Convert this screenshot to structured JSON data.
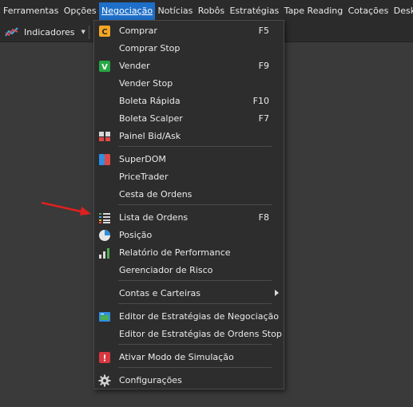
{
  "menubar": {
    "items": [
      "Ferramentas",
      "Opções",
      "Negociação",
      "Notícias",
      "Robôs",
      "Estratégias",
      "Tape Reading",
      "Cotações",
      "Desktop"
    ],
    "active_index": 2
  },
  "toolbar": {
    "indicators_label": "Indicadores"
  },
  "menu": {
    "comprar": {
      "label": "Comprar",
      "shortcut": "F5",
      "badge": "C"
    },
    "comprar_stop": {
      "label": "Comprar Stop"
    },
    "vender": {
      "label": "Vender",
      "shortcut": "F9",
      "badge": "V"
    },
    "vender_stop": {
      "label": "Vender Stop"
    },
    "boleta_rapida": {
      "label": "Boleta Rápida",
      "shortcut": "F10"
    },
    "boleta_scalper": {
      "label": "Boleta Scalper",
      "shortcut": "F7"
    },
    "painel_bid_ask": {
      "label": "Painel Bid/Ask"
    },
    "superdom": {
      "label": "SuperDOM"
    },
    "pricetrader": {
      "label": "PriceTrader"
    },
    "cesta_ordens": {
      "label": "Cesta de Ordens"
    },
    "lista_ordens": {
      "label": "Lista de Ordens",
      "shortcut": "F8"
    },
    "posicao": {
      "label": "Posição"
    },
    "relatorio_performance": {
      "label": "Relatório de Performance"
    },
    "gerenciador_risco": {
      "label": "Gerenciador de Risco"
    },
    "contas_carteiras": {
      "label": "Contas e Carteiras"
    },
    "editor_estrategias_negociacao": {
      "label": "Editor de Estratégias de Negociação"
    },
    "editor_estrategias_stop": {
      "label": "Editor de Estratégias de Ordens Stop"
    },
    "ativar_simulacao": {
      "label": "Ativar Modo de Simulação",
      "badge": "!"
    },
    "configuracoes": {
      "label": "Configurações"
    }
  },
  "colors": {
    "menubar_bg": "#2b2b2b",
    "active_menu": "#1e6fc9",
    "dropdown_bg": "#2d2d2d",
    "comprar_badge": "#f5a623",
    "vender_badge": "#27a844",
    "simulacao_badge": "#d9363e",
    "annotation_arrow": "#e02020"
  },
  "icons": {
    "comprar": "c-badge-icon",
    "vender": "v-badge-icon",
    "painel_bid_ask": "bid-ask-panel-icon",
    "superdom": "superdom-icon",
    "lista_ordens": "order-list-icon",
    "posicao": "pie-chart-icon",
    "relatorio_performance": "bar-chart-icon",
    "editor_negociacao": "strategy-editor-icon",
    "ativar_simulacao": "exclamation-icon",
    "configuracoes": "gear-icon"
  }
}
